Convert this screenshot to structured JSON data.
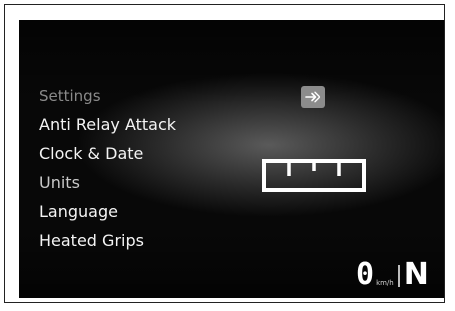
{
  "menu": {
    "header": "Settings",
    "items": [
      {
        "label": "Anti Relay Attack"
      },
      {
        "label": "Clock & Date"
      },
      {
        "label": "Units"
      },
      {
        "label": "Language"
      },
      {
        "label": "Heated Grips"
      }
    ],
    "selected_item": "Units"
  },
  "icons": {
    "enter": "enter-arrow-icon",
    "units_preview": "ruler-icon"
  },
  "status": {
    "speed": "0",
    "speed_unit": "km/h",
    "gear": "N"
  },
  "colors": {
    "screen_background": "#050505",
    "text_primary": "#f4f4f4",
    "text_header": "#8a8a8a",
    "icon_badge": "#8c8c8c"
  }
}
